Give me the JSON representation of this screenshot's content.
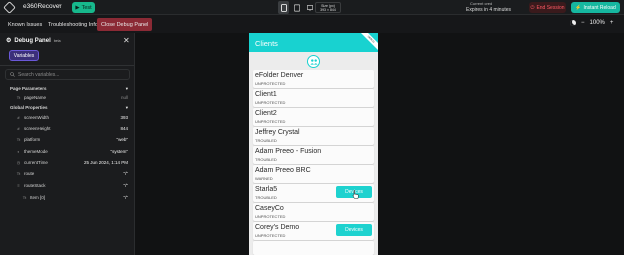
{
  "topbar": {
    "project_name": "e360Recover",
    "test_label": "Test",
    "size_label_1": "Size (px)",
    "size_label_2": "393 × 844",
    "credit_line1": "Current cred",
    "credit_line2": "Expires in 4 minutes",
    "end_session_label": "End Session",
    "instant_reload_label": "Instant Reload"
  },
  "tabs": [
    {
      "label": "Known Issues"
    },
    {
      "label": "Troubleshooting Info"
    },
    {
      "label": "Close Debug Panel"
    }
  ],
  "zoom": {
    "value": "100%",
    "minus": "−",
    "plus": "+"
  },
  "debug_panel": {
    "title": "Debug Panel",
    "beta": "beta",
    "close": "✕",
    "variables_tab": "Variables",
    "search_placeholder": "Search variables...",
    "page_params_title": "Page Parameters",
    "page_params": [
      {
        "name": "pageName",
        "value": "null"
      }
    ],
    "global_title": "Global Properties",
    "globals": [
      {
        "name": "screenWidth",
        "value": "393",
        "icon": "#"
      },
      {
        "name": "screenHeight",
        "value": "844",
        "icon": "#"
      },
      {
        "name": "platform",
        "value": "\"web\"",
        "icon": "Tt"
      },
      {
        "name": "themeMode",
        "value": "\"system\"",
        "icon": "◐"
      },
      {
        "name": "currentTime",
        "value": "25 Jun 2024, 1:14 PM",
        "icon": "◷"
      },
      {
        "name": "route",
        "value": "\"/\"",
        "icon": "Tt"
      },
      {
        "name": "routeStack",
        "value": "\"/\"",
        "icon": "≡"
      },
      {
        "name": "Item [0]",
        "value": "\"/\"",
        "icon": "Tt"
      }
    ]
  },
  "app": {
    "title": "Clients",
    "ribbon": "DEBUG",
    "clients": [
      {
        "name": "eFolder Denver",
        "status": "UNPROTECTED",
        "devices": ""
      },
      {
        "name": "Client1",
        "status": "UNPROTECTED",
        "devices": ""
      },
      {
        "name": "Client2",
        "status": "UNPROTECTED",
        "devices": ""
      },
      {
        "name": "Jeffrey Crystal",
        "status": "TROUBLED",
        "devices": ""
      },
      {
        "name": "Adam Preeo - Fusion",
        "status": "TROUBLED",
        "devices": ""
      },
      {
        "name": "Adam Preeo BRC",
        "status": "WARNED",
        "devices": ""
      },
      {
        "name": "Starla5",
        "status": "TROUBLED",
        "devices": "Devices"
      },
      {
        "name": "CaseyCo",
        "status": "UNPROTECTED",
        "devices": ""
      },
      {
        "name": "Corey's Demo",
        "status": "UNPROTECTED",
        "devices": "Devices"
      }
    ]
  },
  "colors": {
    "accent_teal": "#18d2d0",
    "test_green": "#17b88c",
    "end_session_red": "#ff5a64",
    "close_tab_red": "#8b2a35",
    "variables_purple": "#3b2f7a"
  }
}
